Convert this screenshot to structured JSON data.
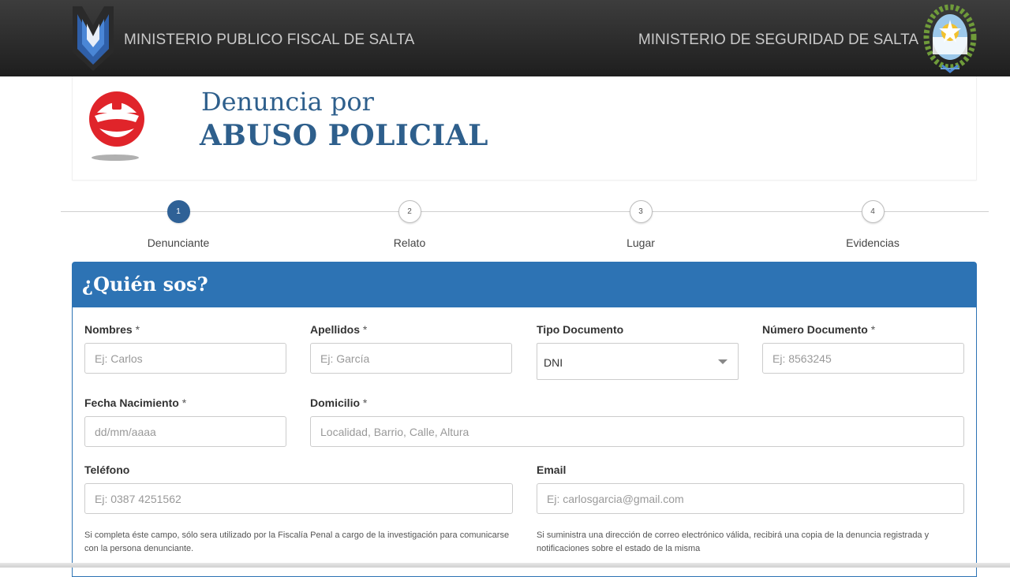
{
  "topbar": {
    "left_title": "MINISTERIO PUBLICO FISCAL DE SALTA",
    "right_title": "MINISTERIO DE SEGURIDAD DE SALTA"
  },
  "header": {
    "line1": "Denuncia por",
    "line2": "ABUSO POLICIAL"
  },
  "steps": [
    {
      "number": "1",
      "label": "Denunciante",
      "active": true
    },
    {
      "number": "2",
      "label": "Relato",
      "active": false
    },
    {
      "number": "3",
      "label": "Lugar",
      "active": false
    },
    {
      "number": "4",
      "label": "Evidencias",
      "active": false
    }
  ],
  "form": {
    "title": "¿Quién sos?",
    "nombres": {
      "label": "Nombres",
      "req": "*",
      "placeholder": "Ej: Carlos"
    },
    "apellidos": {
      "label": "Apellidos",
      "req": "*",
      "placeholder": "Ej: García"
    },
    "tipo_documento": {
      "label": "Tipo Documento",
      "value": "DNI"
    },
    "numero_documento": {
      "label": "Número Documento",
      "req": "*",
      "placeholder": "Ej: 8563245"
    },
    "fecha_nacimiento": {
      "label": "Fecha Nacimiento",
      "req": "*",
      "placeholder": "dd/mm/aaaa"
    },
    "domicilio": {
      "label": "Domicilio",
      "req": "*",
      "placeholder": "Localidad, Barrio, Calle, Altura"
    },
    "telefono": {
      "label": "Teléfono",
      "placeholder": "Ej: 0387 4251562",
      "help": "Si completa éste campo, sólo sera utilizado por la Fiscalía Penal a cargo de la investigación para comunicarse con la persona denunciante."
    },
    "email": {
      "label": "Email",
      "placeholder": "Ej: carlosgarcia@gmail.com",
      "help": "Si suministra una dirección de correo electrónico válida, recibirá una copia de la denuncia registrada y notificaciones sobre el estado de la misma"
    }
  },
  "colors": {
    "primary": "#2d73b4",
    "title": "#2e5f8c",
    "badge_red": "#e0242a"
  }
}
